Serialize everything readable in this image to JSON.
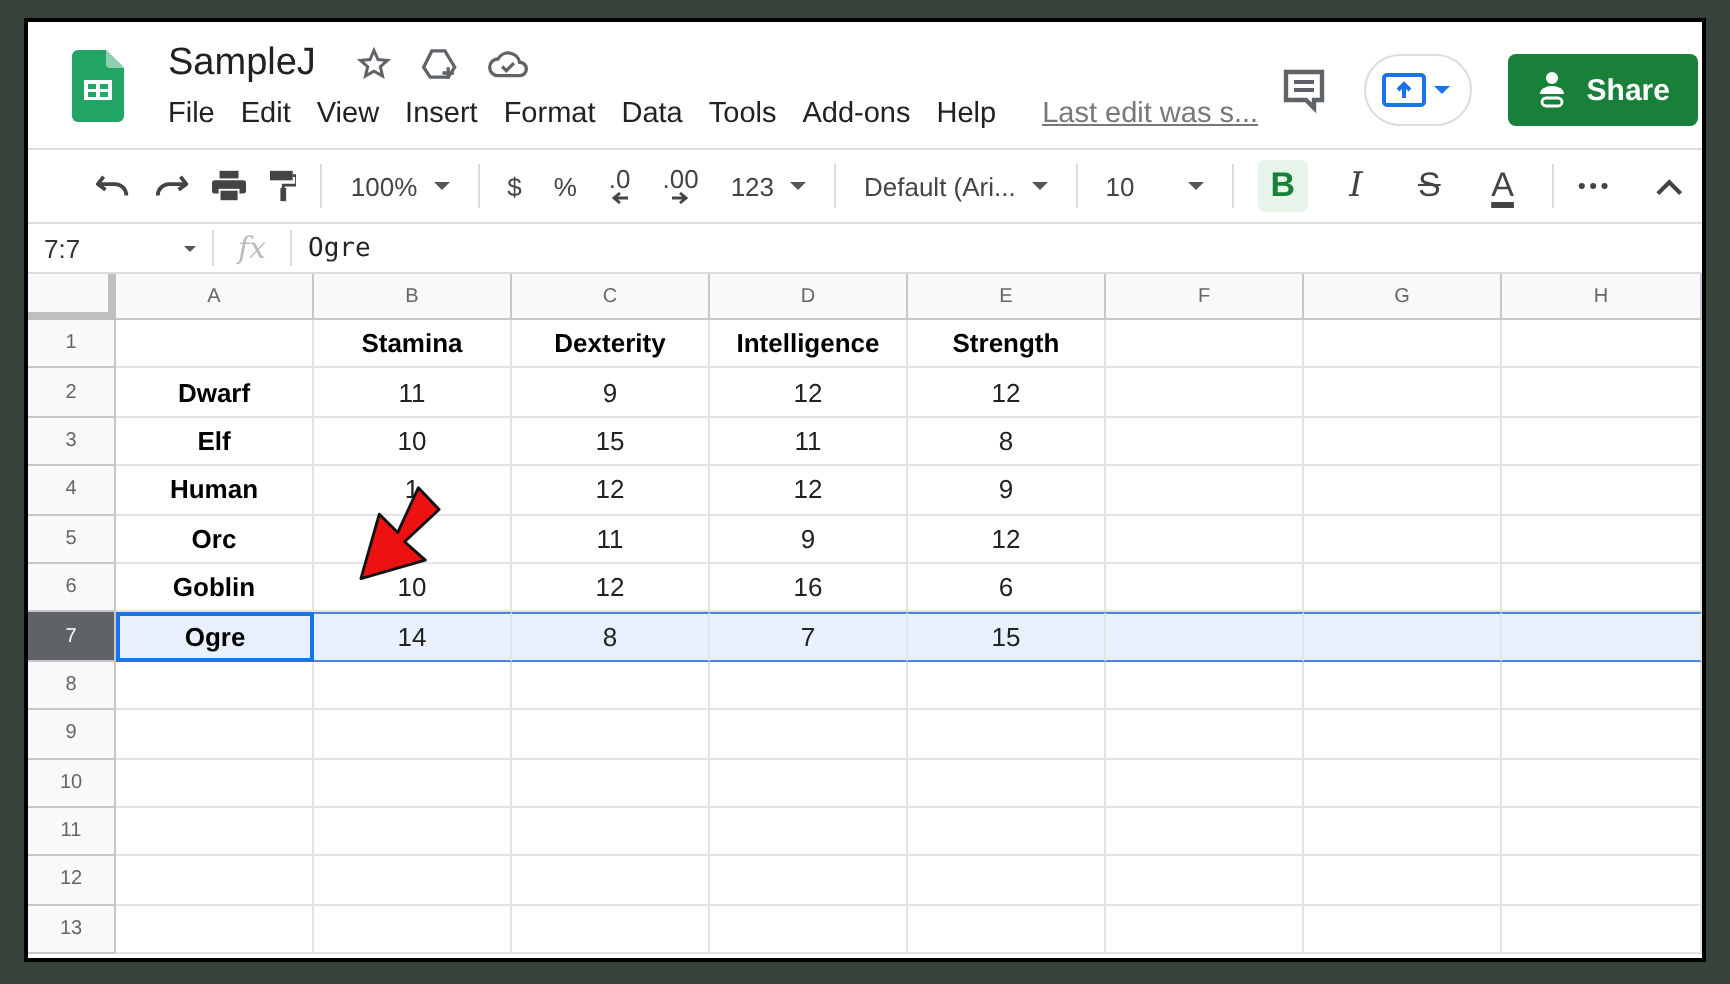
{
  "document": {
    "title": "SampleJ",
    "last_edit": "Last edit was s..."
  },
  "menu": [
    "File",
    "Edit",
    "View",
    "Insert",
    "Format",
    "Data",
    "Tools",
    "Add-ons",
    "Help"
  ],
  "share_button": "Share",
  "toolbar": {
    "zoom": "100%",
    "currency": "$",
    "percent": "%",
    "decrease_decimals": ".0",
    "increase_decimals": ".00",
    "number_format": "123",
    "font": "Default (Ari...",
    "font_size": "10",
    "styles": [
      {
        "label": "B",
        "selected": true
      },
      {
        "label": "I",
        "selected": false
      },
      {
        "label": "S",
        "selected": false
      },
      {
        "label": "A",
        "selected": false
      }
    ]
  },
  "formula_bar": {
    "name_box": "7:7",
    "fx": "fx",
    "value": "Ogre"
  },
  "columns": [
    "A",
    "B",
    "C",
    "D",
    "E",
    "F",
    "G",
    "H"
  ],
  "rows": [
    {
      "number": "1",
      "selected": false,
      "cursor": false,
      "cells": [
        null,
        "Stamina",
        "Dexterity",
        "Intelligence",
        "Strength"
      ]
    },
    {
      "number": "2",
      "selected": false,
      "cursor": false,
      "cells": [
        "Dwarf",
        "11",
        "9",
        "12",
        "12"
      ]
    },
    {
      "number": "3",
      "selected": false,
      "cursor": false,
      "cells": [
        "Elf",
        "10",
        "15",
        "11",
        "8"
      ]
    },
    {
      "number": "4",
      "selected": false,
      "cursor": false,
      "cells": [
        "Human",
        "1",
        "12",
        "12",
        "9"
      ]
    },
    {
      "number": "5",
      "selected": false,
      "cursor": false,
      "cells": [
        "Orc",
        null,
        "11",
        "9",
        "12"
      ]
    },
    {
      "number": "6",
      "selected": false,
      "cursor": false,
      "cells": [
        "Goblin",
        "10",
        "12",
        "16",
        "6"
      ]
    },
    {
      "number": "7",
      "selected": true,
      "cursor": true,
      "cells": [
        "Ogre",
        "14",
        "8",
        "7",
        "15"
      ]
    },
    {
      "number": "8",
      "selected": false,
      "cursor": false
    },
    {
      "number": "9",
      "selected": false,
      "cursor": false
    },
    {
      "number": "10",
      "selected": false,
      "cursor": false
    },
    {
      "number": "11",
      "selected": false,
      "cursor": false
    },
    {
      "number": "12",
      "selected": false,
      "cursor": false
    },
    {
      "number": "13",
      "selected": false,
      "cursor": false
    }
  ]
}
